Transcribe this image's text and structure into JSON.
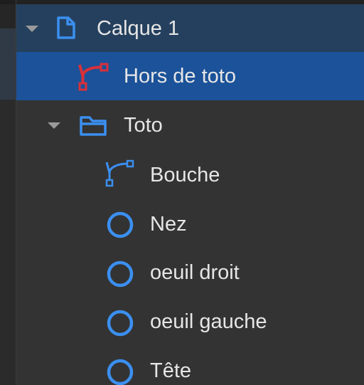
{
  "layers_panel": {
    "items": [
      {
        "label": "Calque 1",
        "icon": "document-icon",
        "expanded": true
      },
      {
        "label": "Hors de toto",
        "icon": "bezier-path-icon",
        "selected": true
      },
      {
        "label": "Toto",
        "icon": "folder-icon",
        "expanded": true
      },
      {
        "label": "Bouche",
        "icon": "bezier-path-icon"
      },
      {
        "label": "Nez",
        "icon": "circle-icon"
      },
      {
        "label": "oeuil droit",
        "icon": "circle-icon"
      },
      {
        "label": "oeuil gauche",
        "icon": "circle-icon"
      },
      {
        "label": "Tête",
        "icon": "circle-icon"
      }
    ]
  },
  "colors": {
    "layer_row_bg": "#25405e",
    "selected_row_bg": "#1b5299",
    "panel_bg": "#333333",
    "icon_blue": "#3b8ff0",
    "icon_red": "#d8303a",
    "text": "#e6e6e6"
  }
}
